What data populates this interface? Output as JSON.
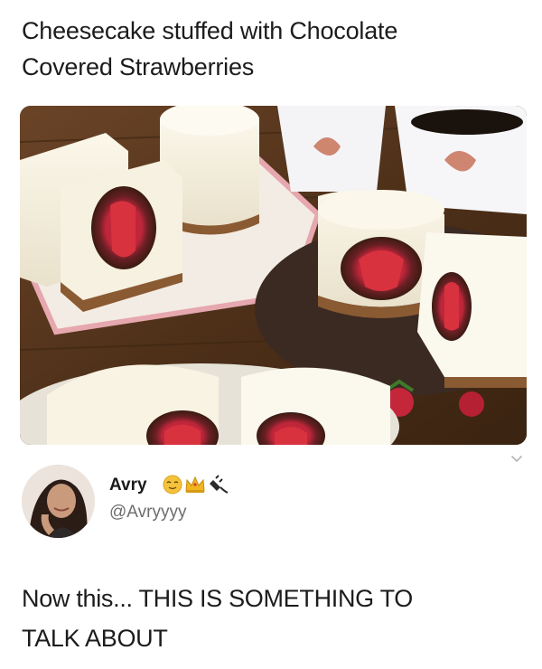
{
  "post": {
    "caption_line1": "Cheesecake stuffed with Chocolate",
    "caption_line2": "Covered Strawberries"
  },
  "image": {
    "subject": "cheesecake-with-chocolate-covered-strawberries-photo"
  },
  "author": {
    "name": "Avry",
    "handle": "@Avryyyy",
    "badges": [
      "relieved-face-emoji-icon",
      "crown-emoji-icon",
      "plug-emoji-icon"
    ]
  },
  "tweet": {
    "line1": "Now this... THIS IS SOMETHING TO",
    "line2": "TALK ABOUT"
  },
  "colors": {
    "text": "#1c1c1c",
    "handle": "#6d6d6d",
    "background": "#ffffff"
  }
}
